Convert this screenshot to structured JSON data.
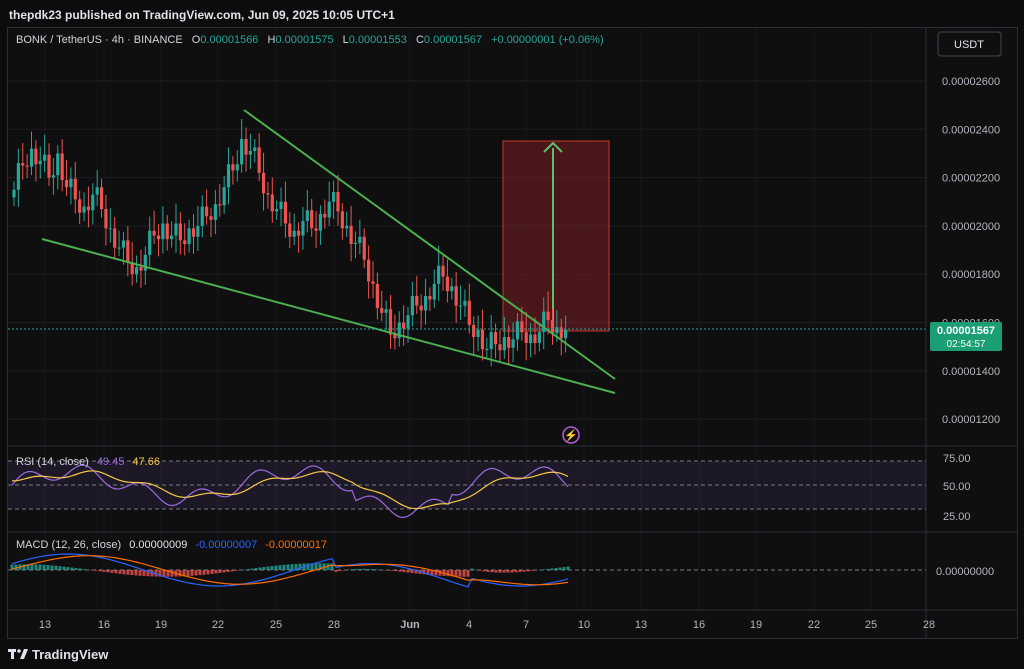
{
  "header": {
    "publisher_line": "thepdk23 published on TradingView.com, Jun 09, 2025 10:05 UTC+1"
  },
  "legend": {
    "symbol": "BONK / TetherUS · 4h · BINANCE",
    "o_label": "O",
    "o_value": "0.00001566",
    "h_label": "H",
    "h_value": "0.00001575",
    "l_label": "L",
    "l_value": "0.00001553",
    "c_label": "C",
    "c_value": "0.00001567",
    "change": "+0.00000001 (+0.06%)"
  },
  "currency_button": "USDT",
  "price_axis": {
    "ticks": [
      "0.00002600",
      "0.00002400",
      "0.00002200",
      "0.00002000",
      "0.00001800",
      "0.00001600",
      "0.00001400",
      "0.00001200"
    ]
  },
  "last_price": {
    "value": "0.00001567",
    "countdown": "02:54:57"
  },
  "rsi": {
    "title": "RSI (14, close)",
    "value1": "49.45",
    "value2": "47.66",
    "ticks": [
      "75.00",
      "50.00",
      "25.00"
    ]
  },
  "macd": {
    "title": "MACD (12, 26, close)",
    "value1": "0.00000009",
    "value2": "-0.00000007",
    "value3": "-0.00000017",
    "tick": "0.00000000"
  },
  "time_axis": {
    "labels": [
      "13",
      "16",
      "19",
      "22",
      "25",
      "28",
      "Jun",
      "4",
      "7",
      "10",
      "13",
      "16",
      "19",
      "22",
      "25",
      "28"
    ]
  },
  "footer": {
    "brand": "TradingView"
  },
  "colors": {
    "up": "#26a69a",
    "down": "#ef5350",
    "trendline": "#4caf50",
    "rsi": "#9c6ade",
    "rsi_ma": "#f7c948",
    "macd": "#2962ff",
    "signal": "#ff6d00",
    "accent": "#2ebd85"
  },
  "chart_data": {
    "type": "candlestick",
    "price_range": [
      1.15e-05,
      2.7e-05
    ],
    "dates_start": "2025-05-12",
    "closes": [
      2.15e-05,
      2.25e-05,
      2.32e-05,
      2.27e-05,
      2.2e-05,
      2.3e-05,
      2.16e-05,
      2.11e-05,
      2.08e-05,
      2.13e-05,
      2.07e-05,
      1.99e-05,
      1.91e-05,
      1.85e-05,
      1.83e-05,
      1.88e-05,
      1.96e-05,
      2.01e-05,
      1.96e-05,
      1.94e-05,
      1.99e-05,
      2e-05,
      2.04e-05,
      2.09e-05,
      2.16e-05,
      2.23e-05,
      2.36e-05,
      2.31e-05,
      2.22e-05,
      2.13e-05,
      2.07e-05,
      2.01e-05,
      1.98e-05,
      2.02e-05,
      1.99e-05,
      2.05e-05,
      2.1e-05,
      2.06e-05,
      2e-05,
      1.93e-05,
      1.86e-05,
      1.76e-05,
      1.64e-05,
      1.55e-05,
      1.6e-05,
      1.63e-05,
      1.67e-05,
      1.71e-05,
      1.76e-05,
      1.79e-05,
      1.75e-05,
      1.67e-05,
      1.59e-05,
      1.57e-05,
      1.49e-05,
      1.51e-05,
      1.54e-05,
      1.53e-05,
      1.56e-05,
      1.55e-05,
      1.56e-05,
      1.61e-05,
      1.58e-05,
      1.57e-05
    ],
    "trendlines": [
      {
        "label": "upper",
        "points": [
          [
            "2025-05-23",
            2.46e-05
          ],
          [
            "2025-06-11",
            1.37e-05
          ]
        ]
      },
      {
        "label": "lower",
        "points": [
          [
            "2025-05-13",
            1.94e-05
          ],
          [
            "2025-06-11",
            1.32e-05
          ]
        ]
      }
    ],
    "target_box": {
      "from": "2025-06-06",
      "to": "2025-06-09",
      "price_low": 1.56e-05,
      "price_high": 2.35e-05
    },
    "rsi_range": [
      0,
      100
    ],
    "rsi_levels": [
      75,
      50,
      25
    ]
  }
}
